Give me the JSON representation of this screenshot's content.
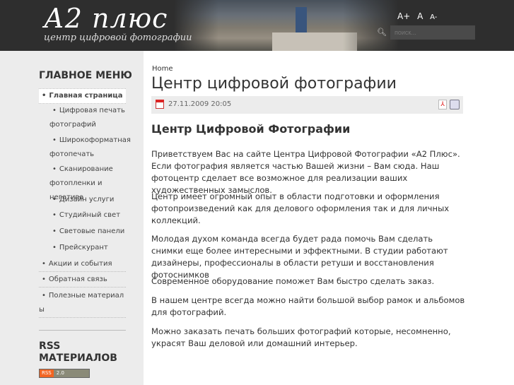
{
  "header": {
    "logo": "А2 плюс",
    "tagline": "центр цифровой фотографии",
    "font_sizes": [
      "A+",
      "A",
      "A-"
    ],
    "search_placeholder": "поиск..."
  },
  "sidebar": {
    "menu_title": "ГЛАВНОЕ МЕНЮ",
    "items": [
      {
        "label": "Главная страница",
        "level": 0,
        "active": true
      },
      {
        "label": "Цифровая печать фотографий",
        "level": 1
      },
      {
        "label": "Широкоформатная фотопечать",
        "level": 1
      },
      {
        "label": "Сканирование фотопленки и негатива",
        "level": 1
      },
      {
        "label": "Дизайн услуги",
        "level": 1
      },
      {
        "label": "Студийный свет",
        "level": 1
      },
      {
        "label": "Световые панели",
        "level": 1
      },
      {
        "label": "Прейскурант",
        "level": 1
      },
      {
        "label": "Акции и события",
        "level": 0
      },
      {
        "label": "Обратная связь",
        "level": 0
      },
      {
        "label": "Полезные материалы",
        "level": 0
      }
    ],
    "rss_title": "RSS МАТЕРИАЛОВ",
    "rss_badge": [
      "RSS",
      "2.0"
    ]
  },
  "main": {
    "breadcrumb": "Home",
    "title": "Центр цифровой фотографии",
    "date": "27.11.2009 20:05",
    "heading": "Центр Цифровой Фотографии",
    "paragraphs": [
      "Приветствуем Вас на сайте Центра Цифровой Фотографии «А2 Плюс». Если фотография является частью Вашей жизни – Вам сюда. Наш фотоцентр сделает все возможное для реализации ваших художественных замыслов.",
      "Центр имеет огромный опыт в области подготовки и оформления фотопроизведений как для делового оформления так и для личных коллекций.",
      "Молодая духом команда всегда будет рада помочь Вам сделать снимки еще более интересными и эффектными. В студии работают дизайнеры, профессионалы в области ретуши и восстановления фотоснимков",
      "Современное оборудование поможет Вам быстро сделать заказ.",
      "В нашем центре всегда можно найти большой выбор рамок и альбомов для фотографий.",
      "Можно заказать печать больших фотографий которые, несомненно, украсят Ваш деловой или домашний интерьер."
    ]
  }
}
